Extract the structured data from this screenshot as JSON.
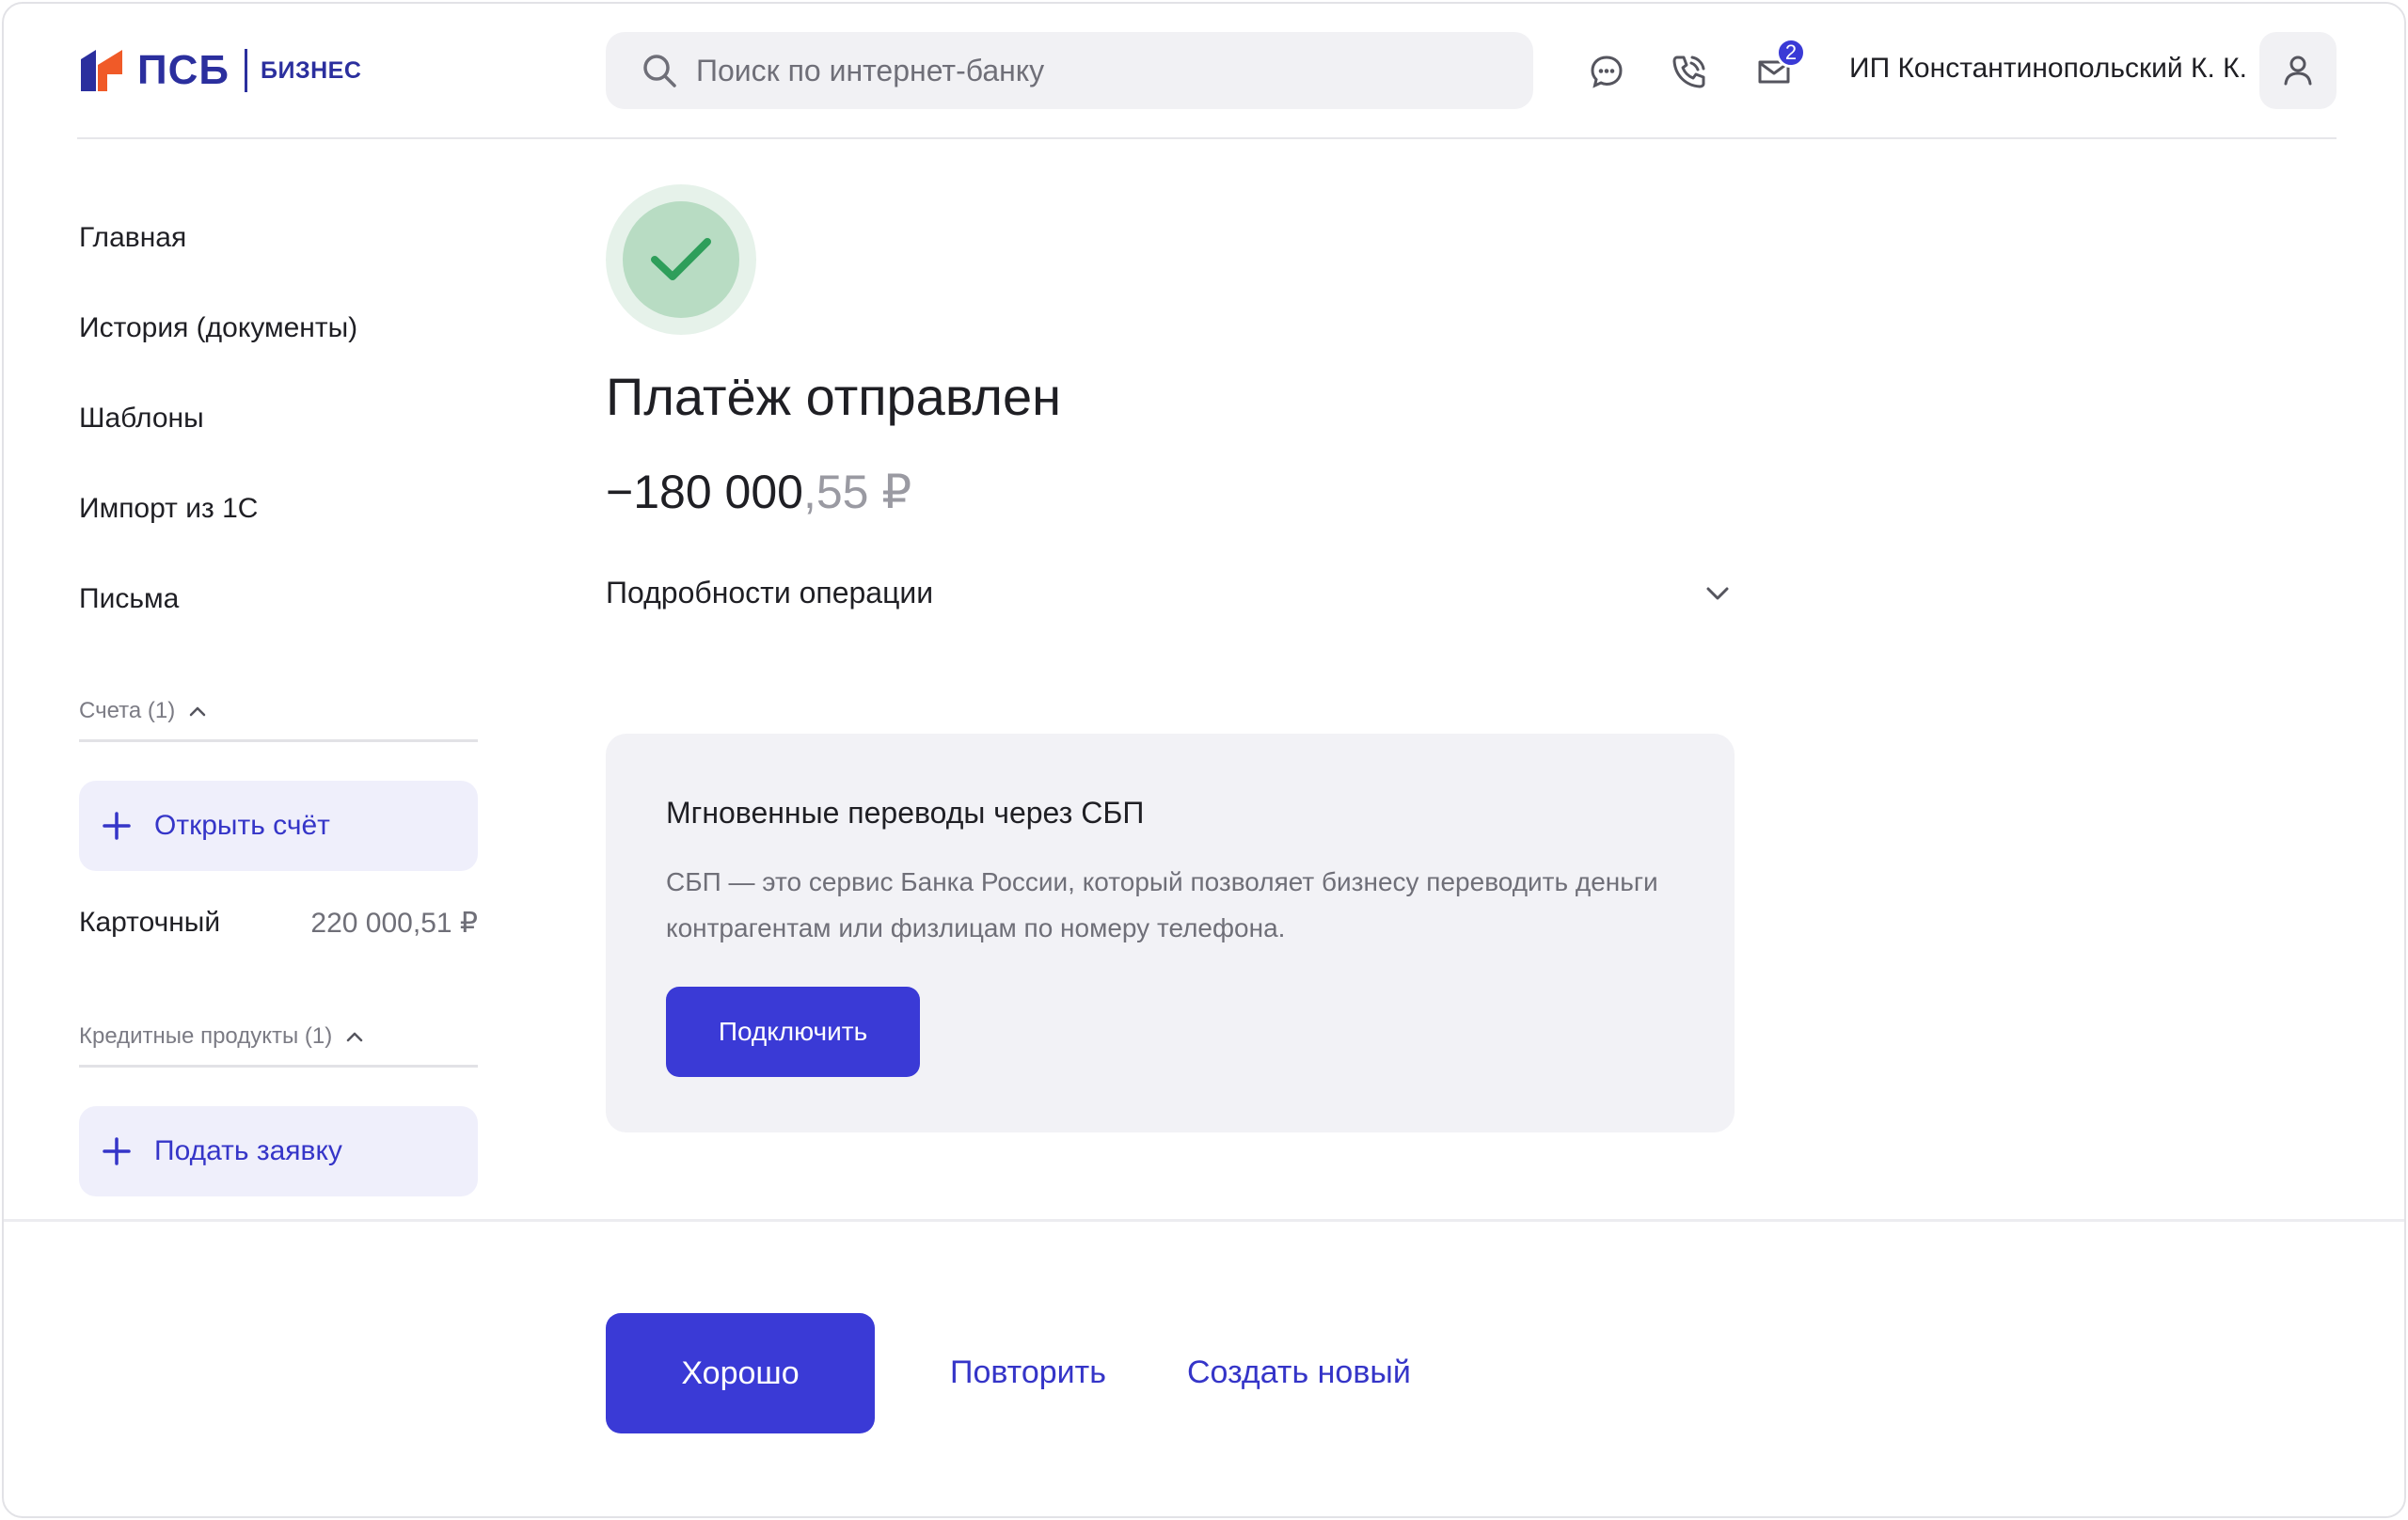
{
  "brand": {
    "name": "ПСБ",
    "sub": "БИЗНЕС",
    "colors": {
      "primary": "#3a3ad6",
      "logo_blue": "#2b2f9e",
      "logo_orange": "#f05a28"
    }
  },
  "header": {
    "search_placeholder": "Поиск по интернет-банку",
    "icons": [
      "chat-icon",
      "phone-icon",
      "mail-icon"
    ],
    "notifications_count": "2",
    "user_name": "ИП Константинопольский К. К."
  },
  "sidebar": {
    "nav": [
      "Главная",
      "История (документы)",
      "Шаблоны",
      "Импорт из 1С",
      "Письма"
    ],
    "accounts": {
      "title": "Счета (1)",
      "open_label": "Открыть счёт",
      "items": [
        {
          "name": "Карточный",
          "amount": "220 000,51 ₽"
        }
      ]
    },
    "credit": {
      "title": "Кредитные продукты (1)",
      "apply_label": "Подать заявку"
    }
  },
  "main": {
    "status": "success",
    "title": "Платёж отправлен",
    "amount_int": "−180 000",
    "amount_frac": ",55 ₽",
    "details_label": "Подробности операции",
    "promo": {
      "title": "Мгновенные переводы через СБП",
      "text": "СБП — это сервис Банка России, который позволяет бизнесу переводить деньги контрагентам или физлицам по номеру телефона.",
      "button": "Подключить"
    }
  },
  "footer": {
    "ok": "Хорошо",
    "repeat": "Повторить",
    "create_new": "Создать новый"
  }
}
